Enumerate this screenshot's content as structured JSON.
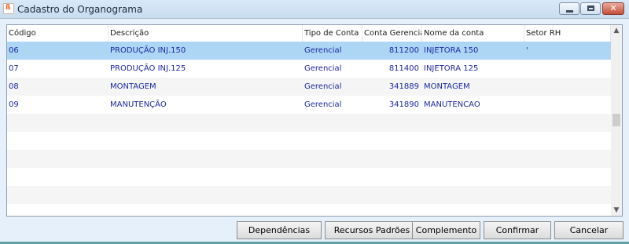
{
  "window": {
    "title": "Cadastro do Organograma",
    "icon": "app-logo-icon",
    "controls": {
      "minimize": "minimize-icon",
      "maximize": "maximize-icon",
      "close": "✕"
    }
  },
  "table": {
    "headers": [
      "Código",
      "Descrição",
      "Tipo de Conta",
      "Conta Gerencial",
      "Nome da conta",
      "Setor RH"
    ],
    "rows": [
      {
        "codigo": "06",
        "descricao": "PRODUÇÃO INJ.150",
        "tipo": "Gerencial",
        "conta": "811200",
        "nome": "INJETORA 150",
        "setor": "'"
      },
      {
        "codigo": "07",
        "descricao": "PRODUÇÃO INJ.125",
        "tipo": "Gerencial",
        "conta": "811400",
        "nome": "INJETORA 125",
        "setor": ""
      },
      {
        "codigo": "08",
        "descricao": "MONTAGEM",
        "tipo": "Gerencial",
        "conta": "341889",
        "nome": "MONTAGEM",
        "setor": ""
      },
      {
        "codigo": "09",
        "descricao": "MANUTENÇÃO",
        "tipo": "Gerencial",
        "conta": "341890",
        "nome": "MANUTENCAO",
        "setor": ""
      }
    ],
    "selected_row": 0
  },
  "scroll": {
    "up": "▲",
    "down": "▼"
  },
  "buttons": {
    "dependencias": "Dependências",
    "recursos": "Recursos Padrões",
    "complemento": "Complemento",
    "confirmar": "Confirmar",
    "cancelar": "Cancelar"
  },
  "colors": {
    "selected_row": "#add6f5",
    "cell_text": "#1c29a0"
  }
}
